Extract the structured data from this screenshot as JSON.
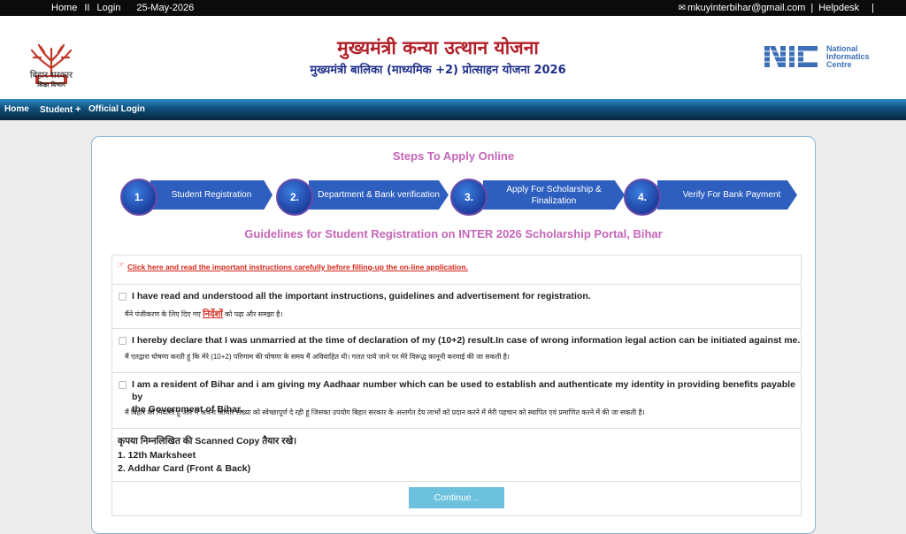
{
  "topbar": {
    "home": "Home",
    "sep": "II",
    "login": "Login",
    "date": "25-May-2026",
    "email": "mkuyinterbihar@gmail.com",
    "sep2": "|",
    "helpdesk": "Helpdesk",
    "sep3": "|"
  },
  "header": {
    "logo_caption_1": "बिहार सरकार",
    "logo_caption_2": "शिक्षा विभाग",
    "title": "मुख्यमंत्री कन्या उत्थान योजना",
    "subtitle": "मुख्यमंत्री बालिका (माध्यमिक +2) प्रोत्साहन योजना 2026",
    "nic_1": "National",
    "nic_2": "Informatics",
    "nic_3": "Centre"
  },
  "nav": {
    "home": "Home",
    "student": "Student",
    "plus": "+",
    "official": "Official Login"
  },
  "steps": {
    "title": "Steps To Apply Online",
    "items": [
      {
        "num": "1.",
        "label": "Student Registration"
      },
      {
        "num": "2.",
        "label": "Department & Bank verification"
      },
      {
        "num": "3.",
        "label": "Apply For Scholarship & Finalization"
      },
      {
        "num": "4.",
        "label": "Verify For Bank Payment"
      }
    ]
  },
  "guidelines": {
    "title": "Guidelines for Student Registration on INTER 2026 Scholarship Portal, Bihar",
    "link_icon": "☞",
    "link": "Click here and read the important instructions carefully before filling-up the on-line application.",
    "decl1_en": "I have read and understood all the important instructions, guidelines and advertisement for registration.",
    "decl1_hi_a": "मैंने पंजीकरण के लिए दिए गए",
    "decl1_hi_link": "निर्देशों",
    "decl1_hi_b": "को पढ़ा और समझा है।",
    "decl2_en": "I hereby declare that I was unmarried at the time of declaration of my (10+2) result.In case of wrong information legal action can be initiated against me.",
    "decl2_hi": "मैं एतद्वारा घोषणा करती हूं कि मेरे (10+2) परिणाम की घोषणा के समय मैं अविवाहित थी। गलत पाये जाने पर मेरे विरूद्ध क़ानूनी करवाई की जा सकती है।",
    "decl3_en_1": "I am a resident of Bihar and i am giving my Aadhaar number which can be used to establish and authenticate my identity in providing benefits payable by",
    "decl3_en_2": "the Government of Bihar.",
    "decl3_hi": "मैं बिहार की निवासी हूं और मैं अपना आधार संख्या को स्वेच्छापूर्ण दे रही हूं जिसका उपयोग बिहार सरकार के अन्तर्गत देय लाभों को प्रदान करने में मेरी पहचान को स्थापित एवं प्रमाणित करने में की जा सकती है।",
    "scan_title": "कृपया निम्नलिखित की Scanned Copy तैयार रखे।",
    "scan_1": "1. 12th Marksheet",
    "scan_2": "2. Addhar Card (Front & Back)",
    "continue": "Continue .."
  },
  "colors": {
    "accent_pink": "#c466b9",
    "step_blue": "#2e5fbf",
    "title_red": "#b3202a",
    "continue_bg": "#6cc1dd"
  }
}
